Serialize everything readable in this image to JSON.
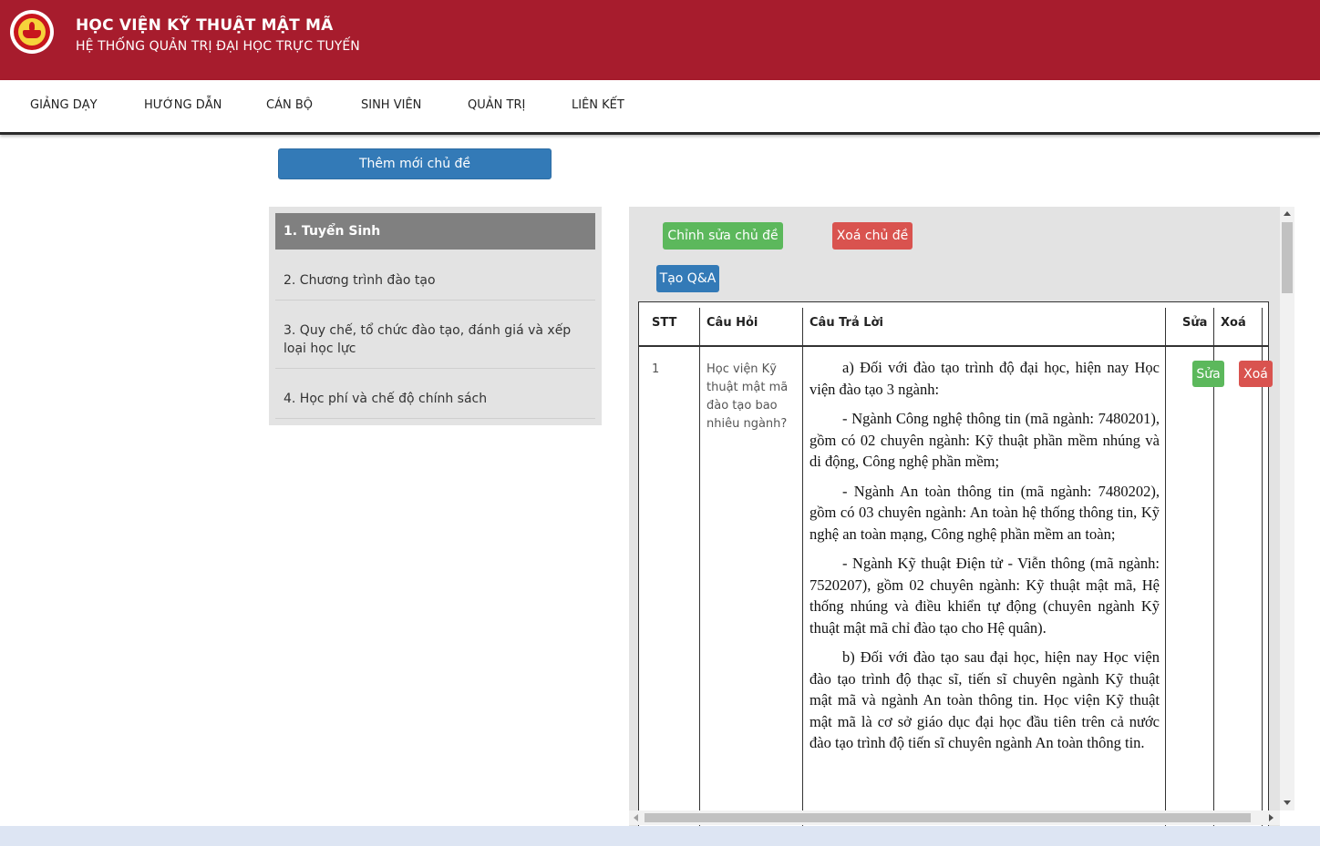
{
  "header": {
    "org_name": "HỌC VIỆN KỸ THUẬT MẬT MÃ",
    "system_name": "HỆ THỐNG QUẢN TRỊ ĐẠI HỌC TRỰC TUYẾN",
    "logo_icon": "academy-seal-logo",
    "color": "#a71c2d"
  },
  "nav": {
    "items": [
      "GIẢNG DẠY",
      "HƯỚNG DẪN",
      "CÁN BỘ",
      "SINH VIÊN",
      "QUẢN TRỊ",
      "LIÊN KẾT"
    ]
  },
  "add_topic_label": "Thêm mới chủ đề",
  "topics": [
    {
      "label": "1. Tuyển Sinh",
      "active": true
    },
    {
      "label": "2. Chương trình đào tạo",
      "active": false
    },
    {
      "label": "3. Quy chế, tổ chức đào tạo, đánh giá và xếp loại học lực",
      "active": false
    },
    {
      "label": "4. Học phí và chế độ chính sách",
      "active": false
    }
  ],
  "detail": {
    "edit_topic_label": "Chỉnh sửa chủ đề",
    "delete_topic_label": "Xoá chủ đề",
    "create_qa_label": "Tạo Q&A",
    "table": {
      "columns": [
        "STT",
        "Câu Hỏi",
        "Câu Trả Lời",
        "Sửa",
        "Xoá"
      ],
      "rows": [
        {
          "stt": "1",
          "question": "Học viện Kỹ thuật mật mã đào tạo bao nhiêu ngành?",
          "answer": [
            "a) Đối với đào tạo trình độ đại học, hiện nay Học viện đào tạo 3 ngành:",
            "- Ngành Công nghệ thông tin (mã ngành: 7480201), gồm có 02 chuyên ngành: Kỹ thuật phần mềm nhúng và di động, Công nghệ phần mềm;",
            "- Ngành An toàn thông tin (mã ngành: 7480202), gồm có 03 chuyên ngành: An toàn hệ thống thông tin, Kỹ nghệ an toàn mạng, Công nghệ phần mềm an toàn;",
            "- Ngành Kỹ thuật Điện tử - Viễn thông (mã ngành: 7520207), gồm 02 chuyên ngành: Kỹ thuật mật mã, Hệ thống nhúng và điều khiển tự động (chuyên ngành Kỹ thuật mật mã chỉ đào tạo cho Hệ quân).",
            "b) Đối với đào tạo sau đại học, hiện nay Học viện đào tạo trình độ thạc sĩ, tiến sĩ chuyên ngành Kỹ thuật mật mã và ngành An toàn thông tin. Học viện Kỹ thuật mật mã là cơ sở giáo dục đại học đầu tiên trên cả nước đào tạo trình độ tiến sĩ chuyên ngành An toàn thông tin."
          ],
          "edit_label": "Sửa",
          "delete_label": "Xoá"
        }
      ]
    }
  },
  "colors": {
    "primary": "#337ab7",
    "success": "#5cb85c",
    "danger": "#d9534f",
    "active_topic": "#808080"
  }
}
